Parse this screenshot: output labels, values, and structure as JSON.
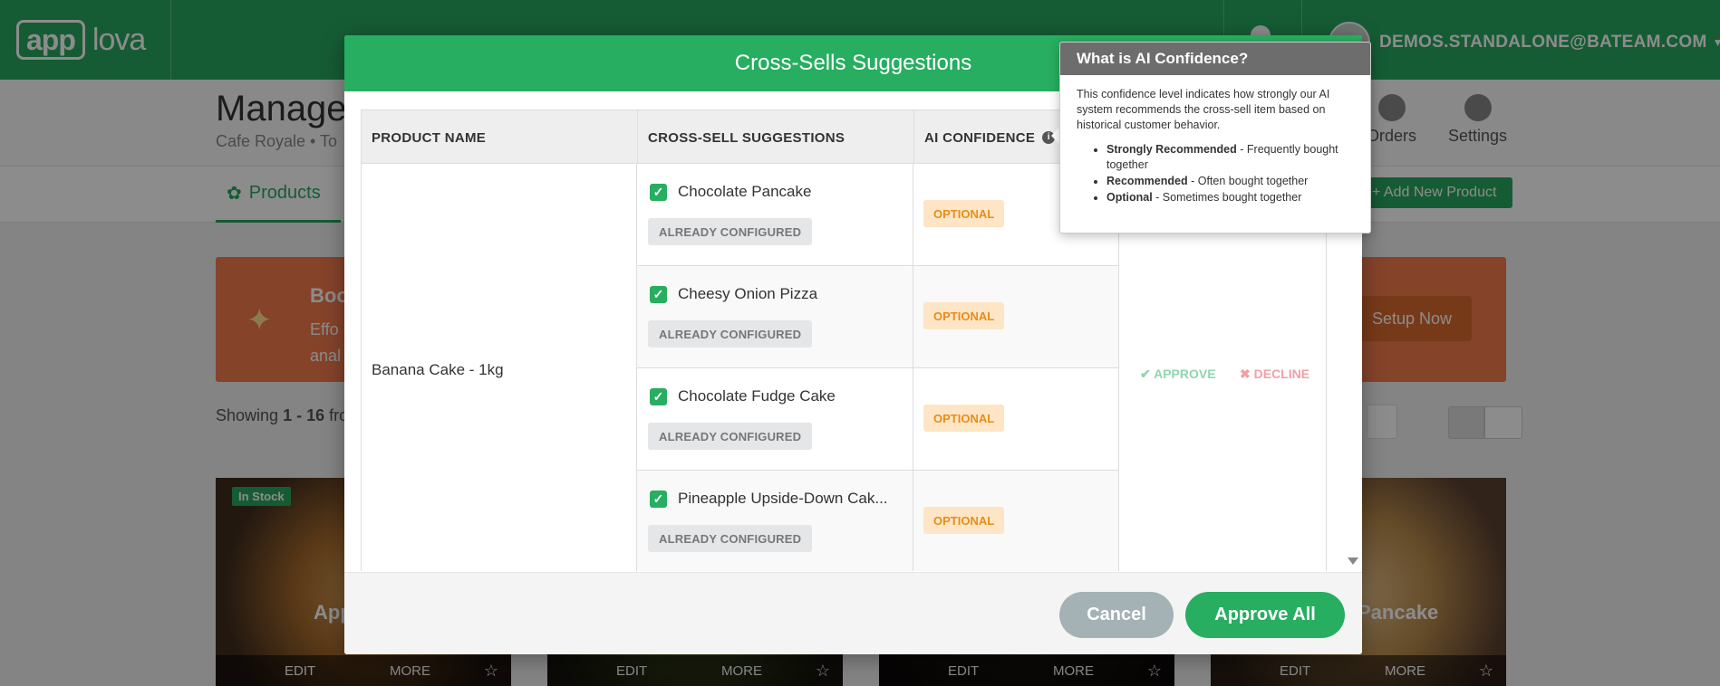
{
  "app": {
    "logo_box": "app",
    "logo_rest": "lova",
    "user_email": "DEMOS.STANDALONE@BATEAM.COM"
  },
  "background": {
    "page_title": "Manage",
    "page_subtitle": "Cafe Royale  •  To",
    "nav": {
      "orders": "Orders",
      "settings": "Settings"
    },
    "tab_products": "Products",
    "add_product": "+ Add New Product",
    "banner_title": "Boo",
    "banner_text_1": "Effo",
    "banner_text_2": "anal",
    "setup_now": "Setup Now",
    "showing_prefix": "Showing ",
    "showing_range": "1 - 16",
    "showing_suffix": " fro",
    "cards": [
      {
        "name": "App",
        "stock": "In Stock",
        "edit": "EDIT",
        "more": "MORE"
      },
      {
        "name": "",
        "edit": "EDIT",
        "more": "MORE"
      },
      {
        "name": "",
        "edit": "EDIT",
        "more": "MORE"
      },
      {
        "name": "Pancake",
        "edit": "EDIT",
        "more": "MORE"
      }
    ]
  },
  "modal": {
    "title": "Cross-Sells Suggestions",
    "columns": {
      "product": "PRODUCT NAME",
      "suggestions": "CROSS-SELL SUGGESTIONS",
      "confidence": "AI CONFIDENCE"
    },
    "product_name": "Banana Cake - 1kg",
    "suggestions": [
      {
        "name": "Chocolate Pancake",
        "status": "ALREADY CONFIGURED",
        "confidence": "OPTIONAL"
      },
      {
        "name": "Cheesy Onion Pizza",
        "status": "ALREADY CONFIGURED",
        "confidence": "OPTIONAL"
      },
      {
        "name": "Chocolate Fudge Cake",
        "status": "ALREADY CONFIGURED",
        "confidence": "OPTIONAL"
      },
      {
        "name": "Pineapple Upside-Down Cak...",
        "status": "ALREADY CONFIGURED",
        "confidence": "OPTIONAL"
      }
    ],
    "actions": {
      "approve": "APPROVE",
      "decline": "DECLINE"
    },
    "cancel": "Cancel",
    "approve_all": "Approve All"
  },
  "popover": {
    "title": "What is AI Confidence?",
    "body": "This confidence level indicates how strongly our AI system recommends the cross-sell item based on historical customer behavior.",
    "items": [
      {
        "term": "Strongly Recommended",
        "desc": " - Frequently bought together"
      },
      {
        "term": "Recommended",
        "desc": " - Often bought together"
      },
      {
        "term": "Optional",
        "desc": " - Sometimes bought together"
      }
    ]
  },
  "colors": {
    "brand_green": "#27ae60",
    "optional_bg": "#fde5c5",
    "optional_text": "#e58e1a",
    "banner": "#f37a4e"
  }
}
